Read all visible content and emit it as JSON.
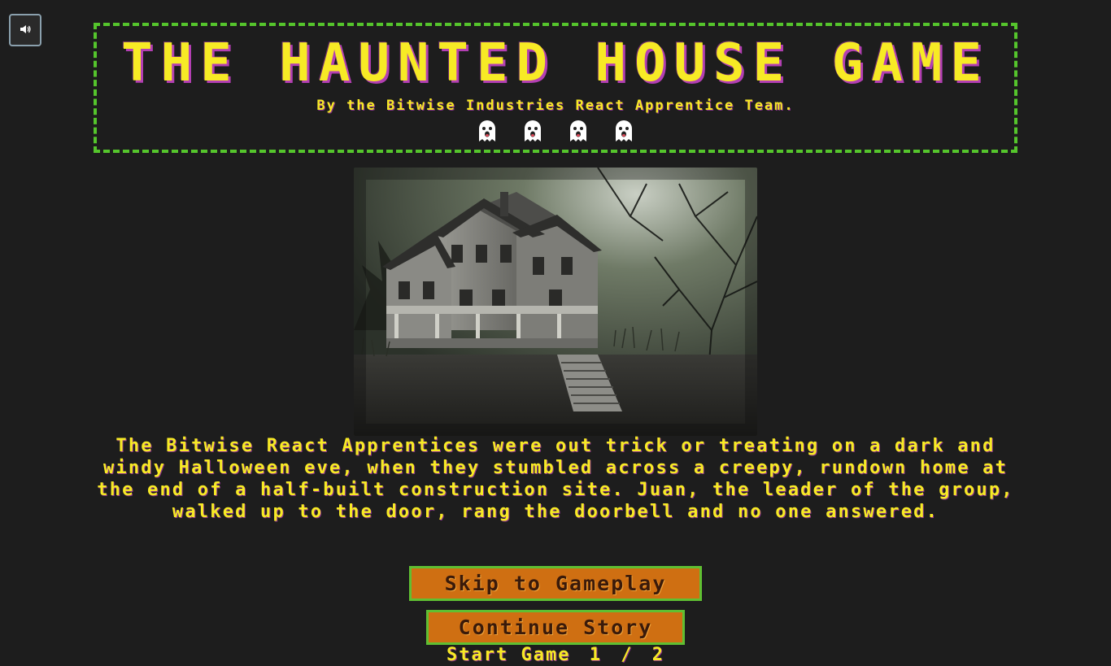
{
  "header": {
    "title": "THE HAUNTED HOUSE GAME",
    "subtitle": "By the Bitwise Industries React Apprentice Team.",
    "ghost_icons": [
      "ghost-icon",
      "ghost-icon",
      "ghost-icon",
      "ghost-icon"
    ]
  },
  "sound_button": {
    "icon": "speaker-icon"
  },
  "story": {
    "text": "The Bitwise React Apprentices were out trick or treating on a dark and windy Halloween eve, when they stumbled across a creepy, rundown home at the end of a half-built construction site. Juan, the leader of the group, walked up to the door, rang the doorbell and no one answered."
  },
  "buttons": {
    "skip_label": "Skip to Gameplay",
    "continue_label": "Continue Story"
  },
  "progress": {
    "label": "Start Game",
    "current": "1",
    "separator": "/",
    "total": "2"
  },
  "colors": {
    "background": "#1d1d1d",
    "text_yellow": "#f7ea25",
    "border_green": "#55c52c",
    "button_orange": "#cf6f12",
    "shadow_purple": "#b33fb3"
  }
}
